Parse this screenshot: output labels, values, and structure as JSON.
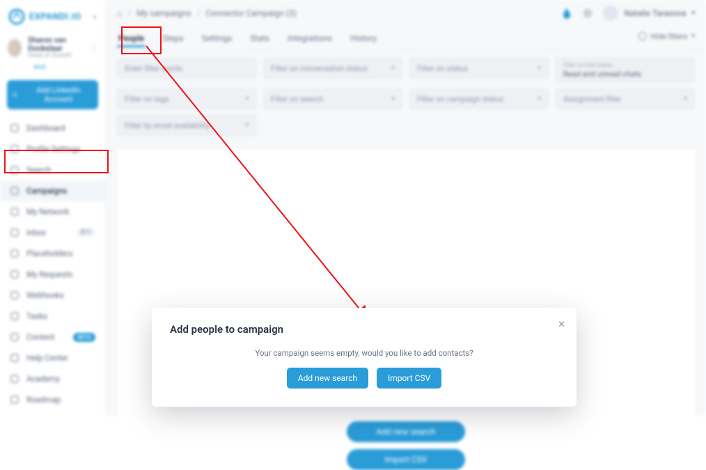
{
  "brand": {
    "name": "EXPANDI.IO"
  },
  "sidebar_user": {
    "name": "Sharon van Donkelaar",
    "title": "Head of Growth",
    "stat": "4643"
  },
  "add_account_label": "Add LinkedIn Account",
  "nav": [
    {
      "icon": "dashboard-icon",
      "label": "Dashboard"
    },
    {
      "icon": "profile-icon",
      "label": "Profile Settings"
    },
    {
      "icon": "search-icon",
      "label": "Search"
    },
    {
      "icon": "megaphone-icon",
      "label": "Campaigns",
      "active": true
    },
    {
      "icon": "network-icon",
      "label": "My Network"
    },
    {
      "icon": "inbox-icon",
      "label": "Inbox",
      "badge": "811"
    },
    {
      "icon": "placeholders-icon",
      "label": "Placeholders"
    },
    {
      "icon": "requests-icon",
      "label": "My Requests"
    },
    {
      "icon": "webhooks-icon",
      "label": "Webhooks"
    },
    {
      "icon": "tasks-icon",
      "label": "Tasks"
    },
    {
      "icon": "content-icon",
      "label": "Content",
      "pill": "BETA"
    },
    {
      "icon": "help-icon",
      "label": "Help Center"
    },
    {
      "icon": "academy-icon",
      "label": "Academy"
    },
    {
      "icon": "roadmap-icon",
      "label": "Roadmap"
    }
  ],
  "breadcrumb": {
    "home": "⌂",
    "level1": "My campaigns",
    "level2": "Connector Campaign (3)"
  },
  "top_user": "Natalie Tarasova",
  "tabs": {
    "items": [
      "People",
      "Steps",
      "Settings",
      "Stats",
      "Integrations",
      "History"
    ],
    "active": 0,
    "hide_filters": "Hide filters"
  },
  "filters": {
    "row1": [
      {
        "placeholder": "Enter filter words",
        "is_input": true
      },
      {
        "label": "Filter on conversation status",
        "dropdown": true
      },
      {
        "label": "Filter on status",
        "dropdown": true
      },
      {
        "small_label": "Filter on chat status",
        "value": "Read and unread chats",
        "dropdown": true
      }
    ],
    "row2": [
      {
        "label": "Filter on tags",
        "dropdown": true
      },
      {
        "label": "Filter on search",
        "dropdown": true
      },
      {
        "label": "Filter on campaign status",
        "dropdown": true
      },
      {
        "label": "Assignment filter",
        "dropdown": true
      }
    ],
    "row3": [
      {
        "label": "Filter by email availability",
        "dropdown": true
      }
    ]
  },
  "bg_buttons": {
    "add_search": "Add new search",
    "import_csv": "Import CSV"
  },
  "modal": {
    "title": "Add people to campaign",
    "message": "Your campaign seems empty, would you like to add contacts?",
    "add_search": "Add new search",
    "import_csv": "Import CSV"
  },
  "colors": {
    "accent": "#2a9cd8",
    "annot": "#e11"
  }
}
